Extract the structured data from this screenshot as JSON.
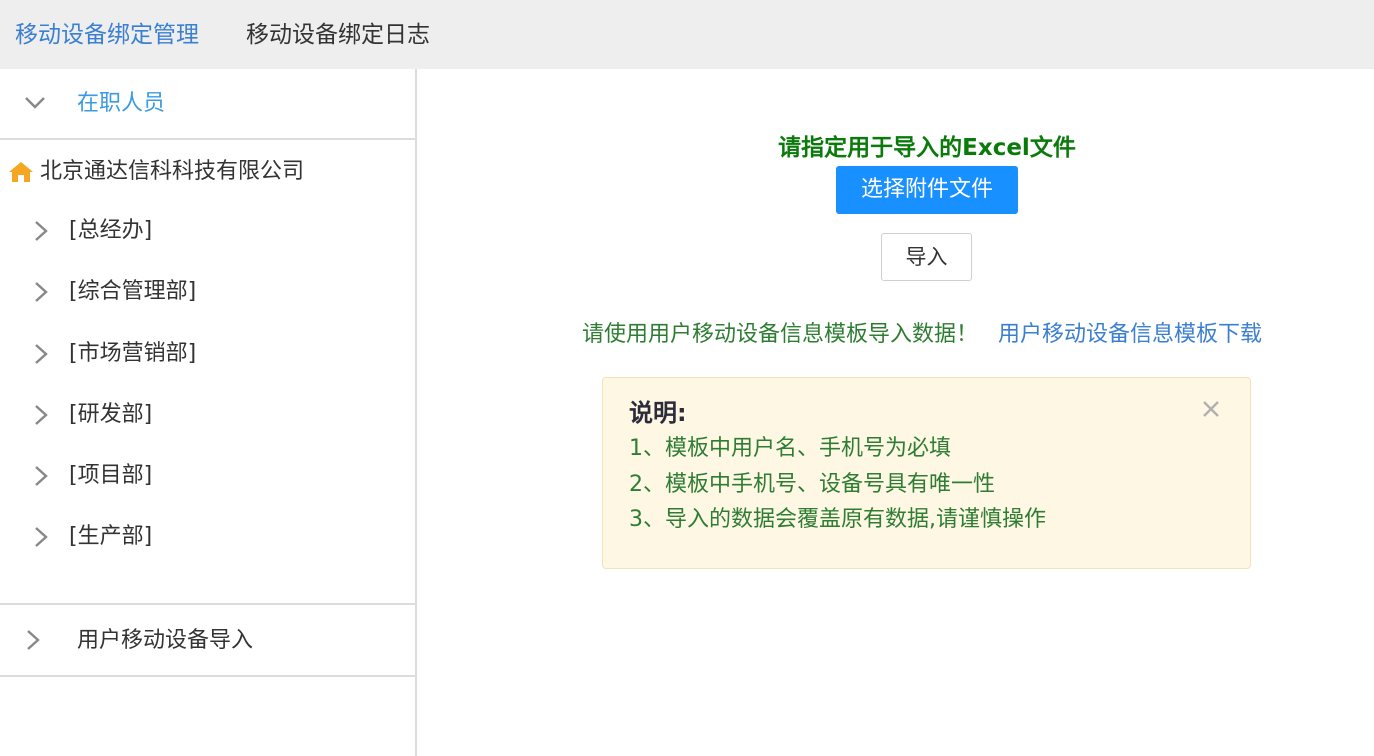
{
  "top_tabs": [
    {
      "label": "移动设备绑定管理",
      "active": true
    },
    {
      "label": "移动设备绑定日志",
      "active": false
    }
  ],
  "sidebar": {
    "section_staff": {
      "label": "在职人员",
      "icon": "chevron-down-icon",
      "expanded": true
    },
    "company": {
      "label": "北京通达信科科技有限公司",
      "icon": "home-icon"
    },
    "departments": [
      {
        "label": "[总经办]"
      },
      {
        "label": "[综合管理部]"
      },
      {
        "label": "[市场营销部]"
      },
      {
        "label": "[研发部]"
      },
      {
        "label": "[项目部]"
      },
      {
        "label": "[生产部]"
      }
    ],
    "section_import": {
      "label": "用户移动设备导入",
      "icon": "chevron-right-icon",
      "expanded": false
    }
  },
  "main": {
    "title": "请指定用于导入的Excel文件",
    "choose_button": "选择附件文件",
    "import_button": "导入",
    "hint_text": "请使用用户移动设备信息模板导入数据！",
    "template_link": "用户移动设备信息模板下载",
    "notice": {
      "title": "说明:",
      "lines": [
        "1、模板中用户名、手机号为必填",
        "2、模板中手机号、设备号具有唯一性",
        "3、导入的数据会覆盖原有数据,请谨慎操作"
      ],
      "close_icon": "close-icon"
    }
  },
  "colors": {
    "accent_blue": "#1890ff",
    "link_blue": "#3b7fd0",
    "green_text": "#2e7d32",
    "title_green": "#0a7a0a",
    "notice_bg": "#fdf7e4",
    "home_icon": "#f5a623"
  }
}
